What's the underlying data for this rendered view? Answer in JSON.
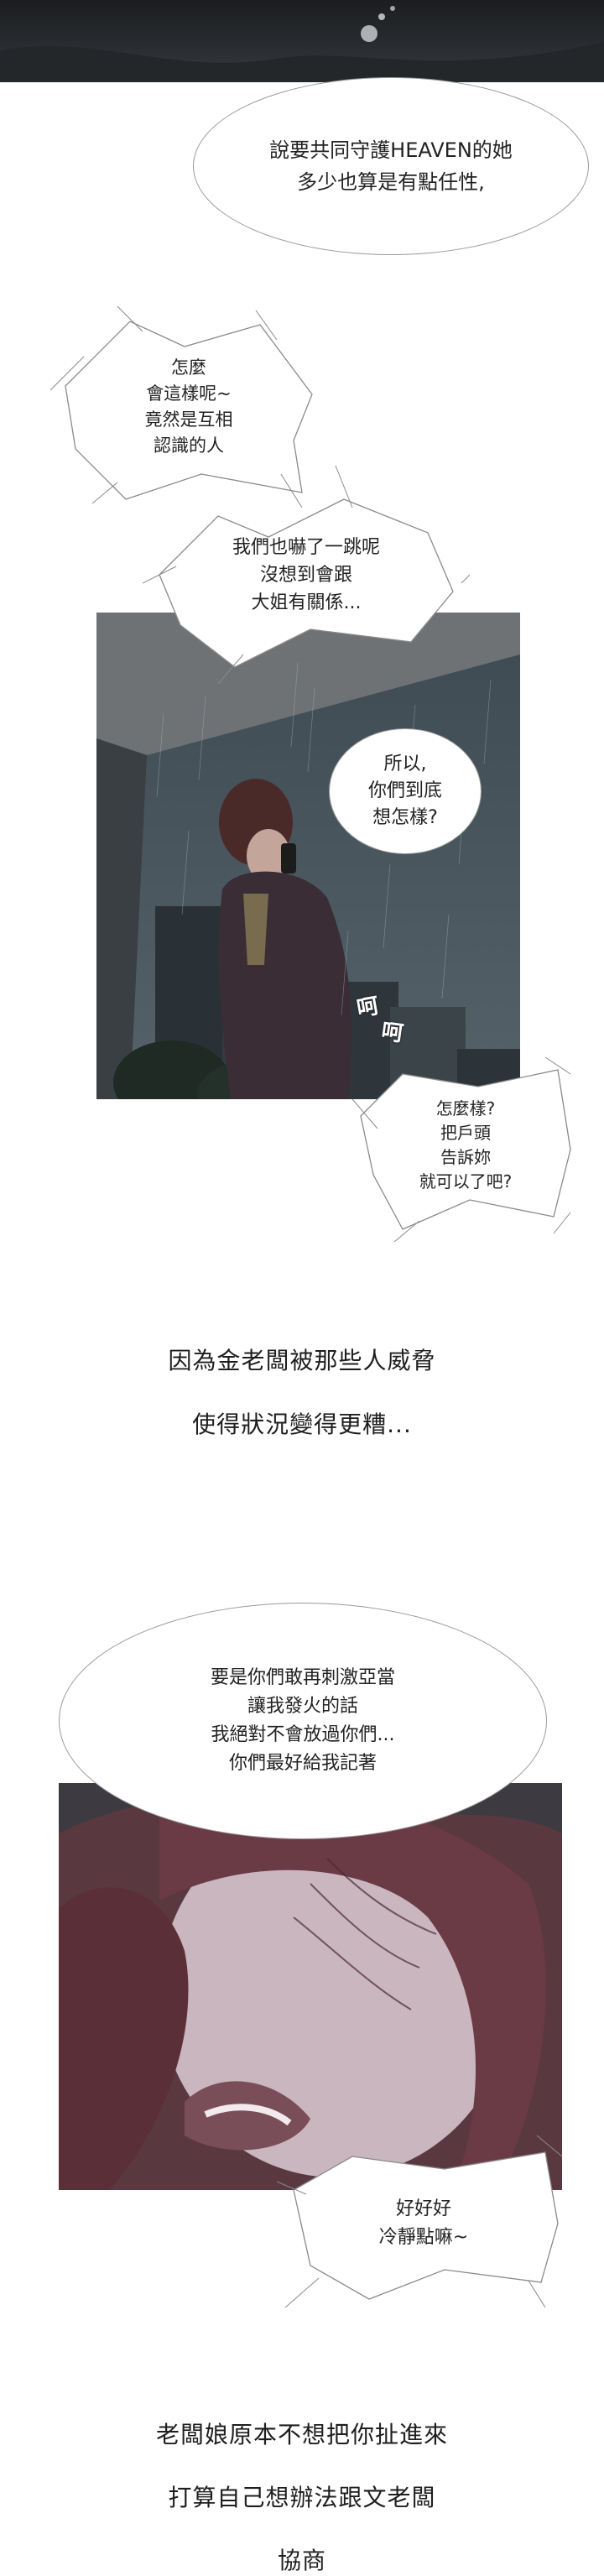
{
  "bubble_top": {
    "lines": [
      "說要共同守護HEAVEN的她",
      "多少也算是有點任性,"
    ]
  },
  "spiky_1": {
    "lines": [
      "怎麼",
      "會這樣呢~",
      "竟然是互相",
      "認識的人"
    ]
  },
  "spiky_2": {
    "lines": [
      "我們也嚇了一跳呢",
      "沒想到會跟",
      "大姐有關係..."
    ]
  },
  "bubble_phone": {
    "lines": [
      "所以,",
      "你們到底",
      "想怎樣?"
    ]
  },
  "sfx_laugh": {
    "lines": [
      "呵",
      "呵"
    ]
  },
  "spiky_3": {
    "lines": [
      "怎麼樣?",
      "把戶頭",
      "告訴妳",
      "就可以了吧?"
    ]
  },
  "narration_1": {
    "lines": [
      "因為金老闆被那些人威脅",
      "使得狀況變得更糟..."
    ]
  },
  "bubble_threat": {
    "lines": [
      "要是你們敢再刺激亞當",
      "讓我發火的話",
      "我絕對不會放過你們...",
      "你們最好給我記著"
    ]
  },
  "spiky_4": {
    "lines": [
      "好好好",
      "冷靜點嘛~"
    ]
  },
  "narration_2": {
    "lines": [
      "老闆娘原本不想把你扯進來",
      "打算自己想辦法跟文老闆",
      "協商"
    ]
  }
}
